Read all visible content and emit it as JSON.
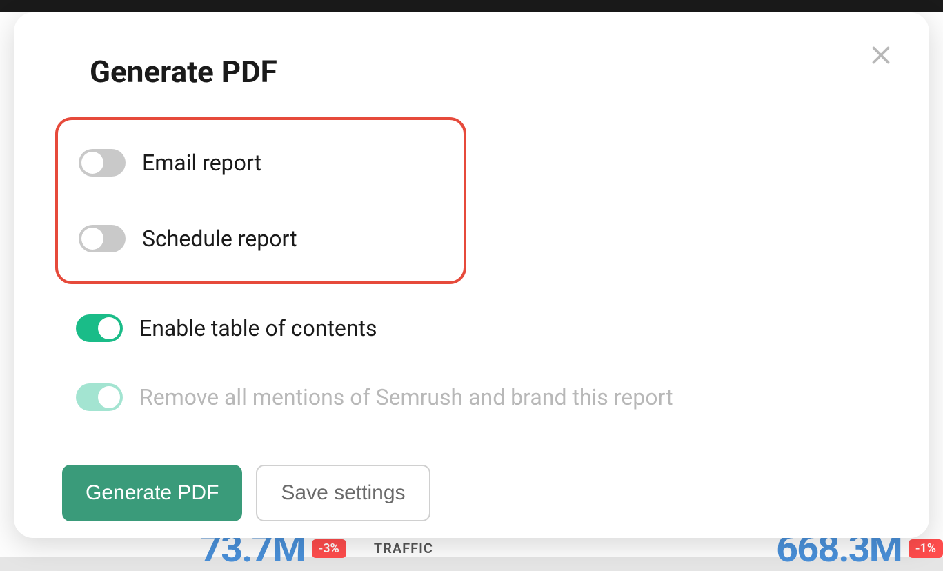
{
  "modal": {
    "title": "Generate PDF",
    "toggles": {
      "email_report": {
        "label": "Email report",
        "on": false
      },
      "schedule_report": {
        "label": "Schedule report",
        "on": false
      },
      "enable_toc": {
        "label": "Enable table of contents",
        "on": true
      },
      "remove_branding": {
        "label": "Remove all mentions of Semrush and brand this report",
        "on": true,
        "disabled": true
      }
    },
    "buttons": {
      "generate": "Generate PDF",
      "save": "Save settings"
    }
  },
  "background": {
    "left_value": "73.7M",
    "left_badge": "-3%",
    "traffic_label": "TRAFFIC",
    "right_value": "668.3M",
    "right_badge": "-1%"
  }
}
